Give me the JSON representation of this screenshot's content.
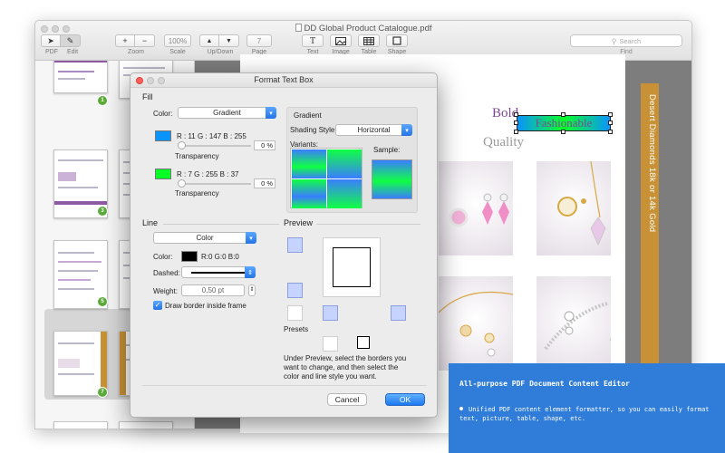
{
  "window": {
    "title": "DD Global Product Catalogue.pdf"
  },
  "toolbar": {
    "pdf_label": "PDF",
    "edit_label": "Edit",
    "zoom_label": "Zoom",
    "zoom_in_icon": "+",
    "zoom_out_icon": "−",
    "scale_value": "100%",
    "scale_label": "Scale",
    "updown_label": "Up/Down",
    "up_icon": "▲",
    "down_icon": "▼",
    "page_value": "7",
    "page_label": "Page",
    "text_icon": "T",
    "text_label": "Text",
    "image_label": "Image",
    "table_label": "Table",
    "shape_label": "Shape",
    "search_placeholder": "Search",
    "find_label": "Find"
  },
  "thumbnails": [
    "1",
    "3",
    "5",
    "7"
  ],
  "page": {
    "bold_word": "Bold",
    "fashionable_word": "Fashionable",
    "quality_word": "Quality",
    "side_text": "Desert Diamonds 18k or 14k Gold"
  },
  "dialog": {
    "title": "Format Text Box",
    "fill": {
      "section": "Fill",
      "color_label": "Color:",
      "color_value": "Gradient",
      "color1_rgb": "R : 11 G : 147 B : 255",
      "color1_transparency_label": "Transparency",
      "color1_pct": "0 %",
      "color2_rgb": "R : 7 G : 255 B : 37",
      "color2_transparency_label": "Transparency",
      "color2_pct": "0 %",
      "gradient_label": "Gradient",
      "shading_label": "Shading Style:",
      "shading_value": "Horizontal",
      "variants_label": "Variants:",
      "sample_label": "Sample:"
    },
    "line": {
      "section": "Line",
      "type_value": "Color",
      "color_label": "Color:",
      "color_value": "R:0 G:0 B:0",
      "dashed_label": "Dashed:",
      "weight_label": "Weight:",
      "weight_value": "0.50 pt",
      "border_inside_label": "Draw border inside frame"
    },
    "preview": {
      "section": "Preview",
      "presets_label": "Presets",
      "hint": "Under Preview, select the borders you want to change, and then select the color and line style you want."
    },
    "cancel_label": "Cancel",
    "ok_label": "OK"
  },
  "callout": {
    "title": "All-purpose PDF Document Content Editor",
    "body": "Unified PDF content element formatter, so you can easily format text, picture, table, shape, etc."
  },
  "colors": {
    "accent_blue": "#2f7cd9",
    "gradient_start": "#0b93ff",
    "gradient_end": "#07ff25",
    "brand_purple": "#7b4a93",
    "gold": "#c89135"
  }
}
